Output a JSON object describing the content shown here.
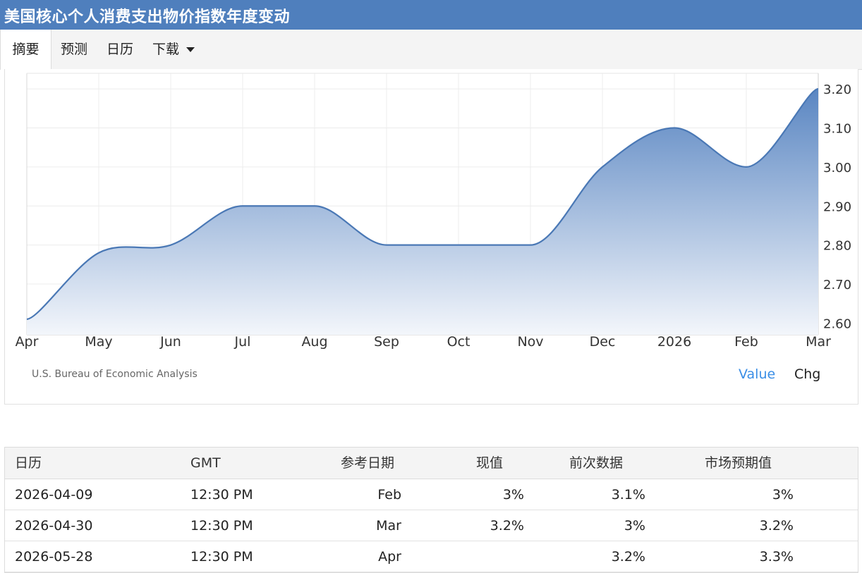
{
  "header": {
    "title": "美国核心个人消费支出物价指数年度变动"
  },
  "tabs": [
    {
      "label": "摘要",
      "active": true
    },
    {
      "label": "预测"
    },
    {
      "label": "日历"
    },
    {
      "label": "下载",
      "icon": "caret-down-icon"
    }
  ],
  "chart_data": {
    "type": "area",
    "categories": [
      "Apr",
      "May",
      "Jun",
      "Jul",
      "Aug",
      "Sep",
      "Oct",
      "Nov",
      "Dec",
      "2026",
      "Feb",
      "Mar"
    ],
    "values": [
      2.61,
      2.78,
      2.8,
      2.9,
      2.9,
      2.8,
      2.8,
      2.8,
      3.0,
      3.1,
      3.0,
      3.2
    ],
    "ylim": [
      2.57,
      3.24
    ],
    "yticks": [
      "2.60",
      "2.70",
      "2.80",
      "2.90",
      "3.00",
      "3.10",
      "3.20"
    ],
    "y_axis_side": "right",
    "grid": true,
    "line_color": "#4a78b5",
    "fill_top_color": "#5a86c2",
    "fill_bottom_color": "#f3f6fb"
  },
  "source": "U.S. Bureau of Economic Analysis",
  "toggles": {
    "value": "Value",
    "chg": "Chg",
    "active_color": "#3a8ee6"
  },
  "table": {
    "headers": {
      "date": "日历",
      "gmt": "GMT",
      "reference": "参考日期",
      "actual": "现值",
      "previous": "前次数据",
      "consensus": "市场预期值"
    },
    "rows": [
      {
        "date": "2026-04-09",
        "gmt": "12:30 PM",
        "reference": "Feb",
        "actual": "3%",
        "previous": "3.1%",
        "consensus": "3%"
      },
      {
        "date": "2026-04-30",
        "gmt": "12:30 PM",
        "reference": "Mar",
        "actual": "3.2%",
        "previous": "3%",
        "consensus": "3.2%"
      },
      {
        "date": "2026-05-28",
        "gmt": "12:30 PM",
        "reference": "Apr",
        "actual": "",
        "previous": "3.2%",
        "consensus": "3.3%"
      }
    ]
  }
}
